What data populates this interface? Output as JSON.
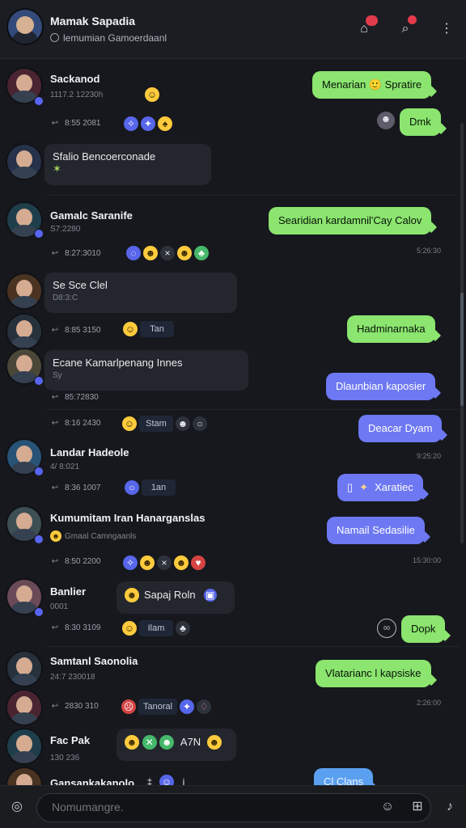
{
  "header": {
    "title": "Mamak Sapadia",
    "subtitle": "lemumian Gamoerdaanl",
    "badge_one": "",
    "badge_two": ""
  },
  "messages": [
    {
      "name": "Sackanod",
      "meta": "1117.2 12230h",
      "time": "8:55 2081",
      "reply": "Menarian 🙂 Spratire",
      "reply2": "Dmk"
    },
    {
      "name": "Sfalio Bencoerconade",
      "meta": "",
      "time": "",
      "reply": "",
      "reply2": ""
    },
    {
      "name": "Gamalc Saranife",
      "meta": "S7:2280",
      "time": "8:27:3010",
      "reply": "Searidian kardamnil'Cay Calov",
      "reply_time": "5:26:30"
    },
    {
      "name": "Se Sce Clel",
      "meta": "D8:3:C",
      "time": "8:85 3150",
      "pill": "Tan",
      "reply": "Hadminarnaka"
    },
    {
      "name": "Ecane Kamarlpenang Innes",
      "meta": "Sy",
      "time": "85:72830",
      "reply": "Dlaunbian kaposier"
    },
    {
      "name": "",
      "meta": "",
      "time": "8:16 2430",
      "pill": "Stam",
      "reply": "Deacar Dyam"
    },
    {
      "name": "Landar Hadeole",
      "meta": "4/ 8:021",
      "time": "8:36 1007",
      "pill": "1an",
      "reply": "Xaratiec",
      "reply_time": "9:25:20"
    },
    {
      "name": "Kumumitam Iran Hanarganslas",
      "meta": "Gmaal Camngaanls",
      "time": "8:50 2200",
      "reply": "Namail Sedasilie",
      "reply_time": "15:30:00"
    },
    {
      "name": "Banlier",
      "meta": "0001",
      "time": "8:30 3109",
      "pill": "Ilam",
      "message": "Sapaj Roln",
      "reply": "Dopk"
    },
    {
      "name": "Samtanl Saonolia",
      "meta": "24:7 230018",
      "time": "2830 310",
      "pill": "Tanoral",
      "reply": "Vlatarianc l kapsiske",
      "reply_time": "2:26:00"
    },
    {
      "name": "Fac Pak",
      "meta": "130 236",
      "time": "",
      "message": "A7N",
      "reply": ""
    },
    {
      "name": "Gansankakanolo",
      "meta": "",
      "time": "",
      "reply": "Cl Clans"
    }
  ],
  "composer": {
    "placeholder": "Nomumangre."
  },
  "colors": {
    "background": "#16181d",
    "green": "#8be56f",
    "blue": "#6d78f2",
    "accent": "#5865f2"
  },
  "icons": [
    "avatar-icon",
    "lock-icon",
    "inbox-icon",
    "search-icon",
    "more-icon",
    "reply-icon",
    "emoji-icon",
    "attachment-icon",
    "sticker-icon",
    "mic-icon"
  ]
}
